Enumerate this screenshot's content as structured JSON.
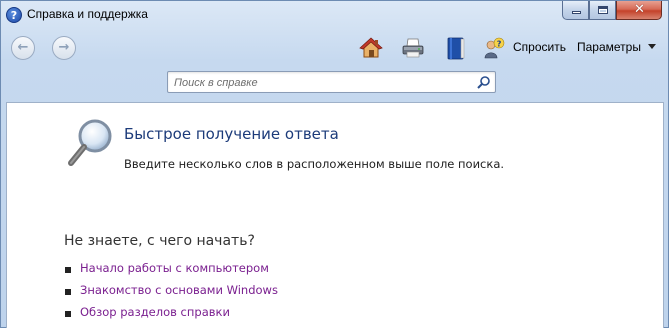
{
  "window": {
    "title": "Справка и поддержка",
    "app_icon_glyph": "?"
  },
  "caption_buttons": {
    "minimize_icon": "minimize-icon",
    "maximize_icon": "maximize-icon",
    "close_glyph": "✕"
  },
  "toolbar": {
    "back_glyph": "←",
    "forward_glyph": "→",
    "icons": [
      "home-icon",
      "print-icon",
      "browse-help-icon",
      "ask-icon"
    ],
    "ask_label": "Спросить",
    "params_label": "Параметры"
  },
  "search": {
    "placeholder": "Поиск в справке"
  },
  "main": {
    "answer_title": "Быстрое получение ответа",
    "answer_desc": "Введите несколько слов в расположенном выше поле поиска.",
    "start_heading": "Не знаете, с чего начать?",
    "links": [
      "Начало работы с компьютером",
      "Знакомство с основами Windows",
      "Обзор разделов справки"
    ]
  },
  "colors": {
    "title_blue": "#1c3b7a",
    "link_purple": "#7a1f8f",
    "close_red": "#c4422a"
  }
}
